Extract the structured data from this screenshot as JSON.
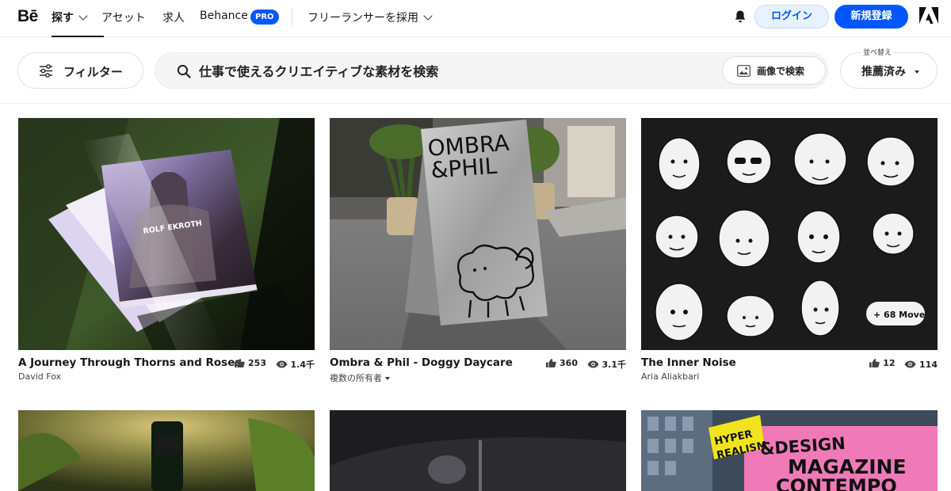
{
  "nav": {
    "logo": "Bē",
    "explore": "探す",
    "assets": "アセット",
    "jobs": "求人",
    "behance": "Behance",
    "pro_badge": "PRO",
    "hire": "フリーランサーを採用",
    "login": "ログイン",
    "signup": "新規登録"
  },
  "filterbar": {
    "filter_label": "フィルター",
    "search_placeholder": "仕事で使えるクリエイティブな素材を検索",
    "image_search_label": "画像で検索",
    "sort_label": "並べ替え",
    "sort_value": "推薦済み"
  },
  "projects": [
    {
      "title": "A Journey Through Thorns and Roses",
      "owner": "David Fox",
      "likes": "253",
      "views": "1.4千"
    },
    {
      "title": "Ombra & Phil - Doggy Daycare",
      "owner": "複数の所有者",
      "likes": "360",
      "views": "3.1千"
    },
    {
      "title": "The Inner Noise",
      "owner": "Aria Aliakbari",
      "likes": "12",
      "views": "114"
    }
  ],
  "artwork_text": {
    "book_cover": "ROLF EKROTH",
    "sign_line1": "OMBRA",
    "sign_line2": "&PHIL",
    "more_tag": "+ 68 Move",
    "magazine_tag1": "HYPER",
    "magazine_tag2": "REALISM",
    "magazine_line1": "&DESIGN",
    "magazine_line2": "MAGAZINE",
    "magazine_line3": "CONTEMPO"
  },
  "icons": {
    "bell": "bell-icon",
    "adobe": "adobe-logo-icon",
    "filter": "sliders-icon",
    "search": "search-icon",
    "image": "image-icon",
    "like": "thumbs-up-icon",
    "views": "eye-icon"
  },
  "colors": {
    "accent": "#0057ff",
    "accent_light": "#e9f0ff",
    "text": "#191919"
  }
}
